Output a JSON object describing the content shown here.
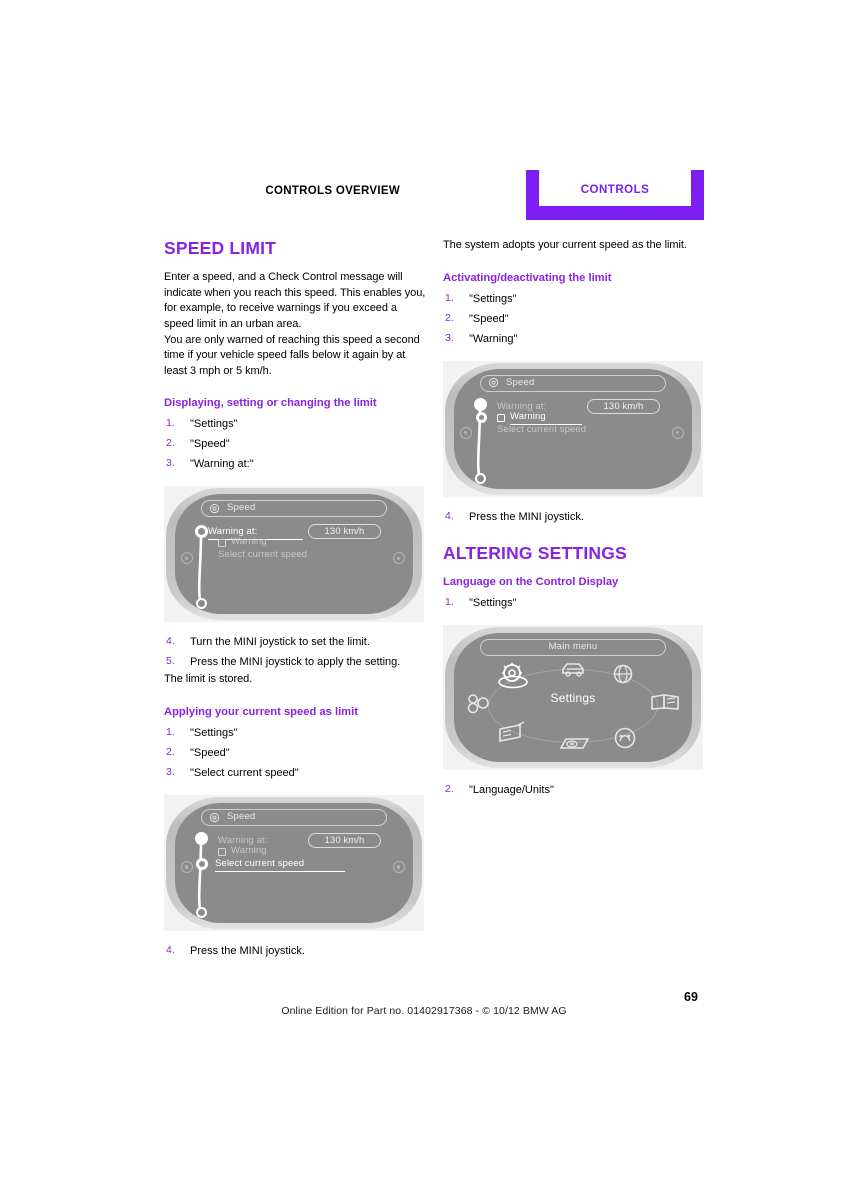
{
  "header": {
    "section_label": "CONTROLS OVERVIEW",
    "tab_label": "CONTROLS",
    "accent_color": "#7b1ff0"
  },
  "left_column": {
    "chapter_title": "SPEED LIMIT",
    "intro_paragraph_1": "Enter a speed, and a Check Control message will indicate when you reach this speed. This enables you, for example, to receive warnings if you exceed a speed limit in an urban area.",
    "intro_paragraph_2": "You are only warned of reaching this speed a second time if your vehicle speed falls below it again by at least 3 mph or 5 km/h.",
    "section_1": {
      "heading": "Displaying, setting or changing the limit",
      "steps": [
        {
          "num": "1.",
          "text": "\"Settings\""
        },
        {
          "num": "2.",
          "text": "\"Speed\""
        },
        {
          "num": "3.",
          "text": "\"Warning at:\""
        }
      ],
      "steps_after": [
        {
          "num": "4.",
          "text": "Turn the MINI joystick to set the limit."
        },
        {
          "num": "5.",
          "text": "Press the MINI joystick to apply the setting."
        }
      ],
      "closing_text": "The limit is stored."
    },
    "section_2": {
      "heading": "Applying your current speed as limit",
      "steps": [
        {
          "num": "1.",
          "text": "\"Settings\""
        },
        {
          "num": "2.",
          "text": "\"Speed\""
        },
        {
          "num": "3.",
          "text": "\"Select current speed\""
        }
      ],
      "steps_after": [
        {
          "num": "4.",
          "text": "Press the MINI joystick."
        }
      ]
    },
    "figure_1": {
      "title": "Speed",
      "row_warning_at": "Warning at:",
      "value": "130 km/h",
      "row_warning": "Warning",
      "row_select_current": "Select current speed",
      "selected_row": "Warning at:"
    },
    "figure_2": {
      "title": "Speed",
      "row_warning_at": "Warning at:",
      "value": "130 km/h",
      "row_warning": "Warning",
      "row_select_current": "Select current speed",
      "selected_row": "Select current speed"
    }
  },
  "right_column": {
    "intro_paragraph": "The system adopts your current speed as the limit.",
    "section_1": {
      "heading": "Activating/deactivating the limit",
      "steps": [
        {
          "num": "1.",
          "text": "\"Settings\""
        },
        {
          "num": "2.",
          "text": "\"Speed\""
        },
        {
          "num": "3.",
          "text": "\"Warning\""
        }
      ],
      "steps_after": [
        {
          "num": "4.",
          "text": "Press the MINI joystick."
        }
      ]
    },
    "chapter_title": "ALTERING SETTINGS",
    "section_2": {
      "heading": "Language on the Control Display",
      "steps": [
        {
          "num": "1.",
          "text": "\"Settings\""
        }
      ],
      "steps_after": [
        {
          "num": "2.",
          "text": "\"Language/Units\""
        }
      ]
    },
    "figure_1": {
      "title": "Speed",
      "row_warning_at": "Warning at:",
      "value": "130 km/h",
      "row_warning": "Warning",
      "row_select_current": "Select current speed",
      "selected_row": "Warning"
    },
    "figure_menu": {
      "title": "Main menu",
      "center_label": "Settings",
      "icons": [
        "settings-gear-icon",
        "vehicle-icon",
        "globe-navigation-icon",
        "book-manual-icon",
        "telephone-icon",
        "radio-icon",
        "media-cd-icon",
        "entertainment-icon"
      ]
    }
  },
  "footer": {
    "edition_note": "Online Edition for Part no. 01402917368 - © 10/12 BMW AG",
    "page_number": "69"
  }
}
